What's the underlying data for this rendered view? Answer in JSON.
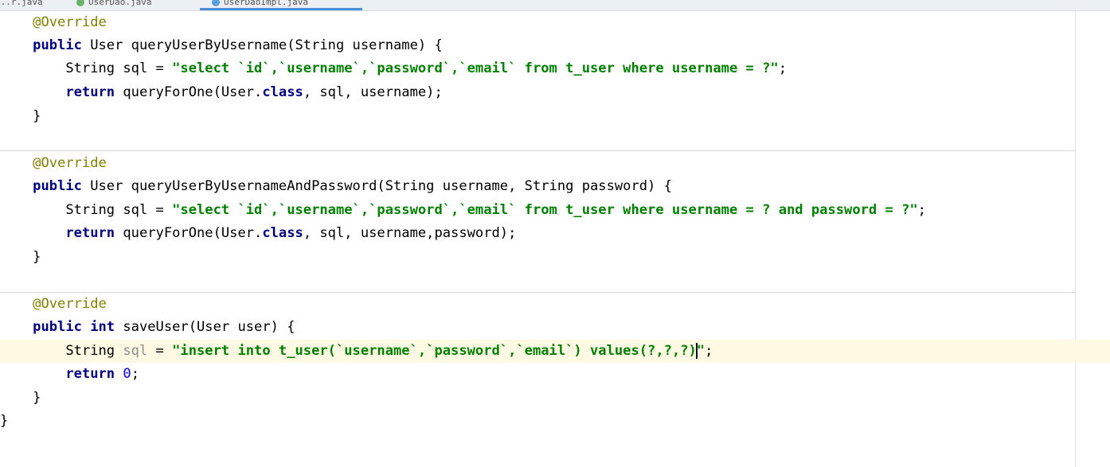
{
  "tabs": [
    {
      "label": "...r.java",
      "color": "#6bb36b"
    },
    {
      "label": "UserDao.java",
      "color": "#6bb36b"
    },
    {
      "label": "UserDaoImpl.java",
      "color": "#5aa0e0"
    }
  ],
  "code": {
    "b1_ann": "@Override",
    "b1_l2_kw": "public",
    "b1_l2_rest": " User queryUserByUsername(String username) {",
    "b1_l3_a": "String sql = ",
    "b1_l3_str": "\"select `id`,`username`,`password`,`email` from t_user where username = ?\"",
    "b1_l3_end": ";",
    "b1_l4_kw": "return",
    "b1_l4_a": " queryForOne(User.",
    "b1_l4_kw2": "class",
    "b1_l4_b": ", sql, username);",
    "b1_close": "}",
    "b2_ann": "@Override",
    "b2_l2_kw": "public",
    "b2_l2_rest": " User queryUserByUsernameAndPassword(String username, String password) {",
    "b2_l3_a": "String sql = ",
    "b2_l3_str": "\"select `id`,`username`,`password`,`email` from t_user where username = ? and password = ?\"",
    "b2_l3_end": ";",
    "b2_l4_kw": "return",
    "b2_l4_a": " queryForOne(User.",
    "b2_l4_kw2": "class",
    "b2_l4_b": ", sql, username,password);",
    "b2_close": "}",
    "b3_ann": "@Override",
    "b3_l2_kw1": "public",
    "b3_l2_kw2": "int",
    "b3_l2_rest": " saveUser(User user) {",
    "b3_l3_a": "String ",
    "b3_l3_var": "sql",
    "b3_l3_b": " = ",
    "b3_l3_str1": "\"insert into t_user(`username`,`password`,`email`) values(?,?,?)",
    "b3_l3_str2": "\"",
    "b3_l3_end": ";",
    "b3_l4_kw": "return",
    "b3_l4_num": "0",
    "b3_l4_end": ";",
    "b3_close": "}",
    "class_close": "}"
  },
  "colors": {
    "annotation": "#808000",
    "keyword": "#000080",
    "string": "#008000",
    "number": "#0000ff",
    "current_line": "#fdf9e3"
  }
}
